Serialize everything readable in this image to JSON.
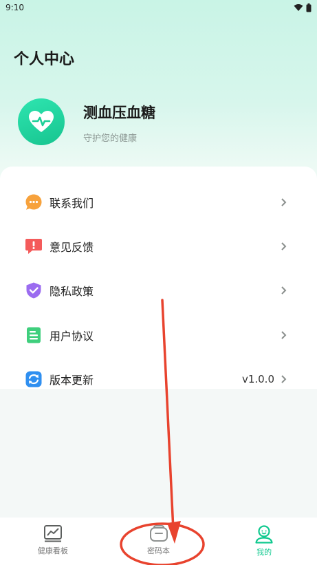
{
  "status_bar": {
    "time": "9:10",
    "icons": [
      "wifi-icon",
      "battery-icon"
    ]
  },
  "header": {
    "title": "个人中心"
  },
  "profile": {
    "app_name": "测血压血糖",
    "slogan": "守护您的健康",
    "logo_icon": "heart-pulse-icon"
  },
  "menu": {
    "items": [
      {
        "label": "联系我们",
        "icon": "chat-bubble-icon",
        "value": ""
      },
      {
        "label": "意见反馈",
        "icon": "feedback-icon",
        "value": ""
      },
      {
        "label": "隐私政策",
        "icon": "shield-icon",
        "value": ""
      },
      {
        "label": "用户协议",
        "icon": "document-icon",
        "value": ""
      },
      {
        "label": "版本更新",
        "icon": "refresh-icon",
        "value": "v1.0.0"
      }
    ]
  },
  "tabbar": {
    "tabs": [
      {
        "label": "健康看板",
        "icon": "chart-board-icon",
        "active": false
      },
      {
        "label": "密码本",
        "icon": "notebook-icon",
        "active": false
      },
      {
        "label": "我的",
        "icon": "user-icon",
        "active": true
      }
    ]
  },
  "colors": {
    "accent": "#10c98f",
    "annotation": "#e8432e"
  }
}
